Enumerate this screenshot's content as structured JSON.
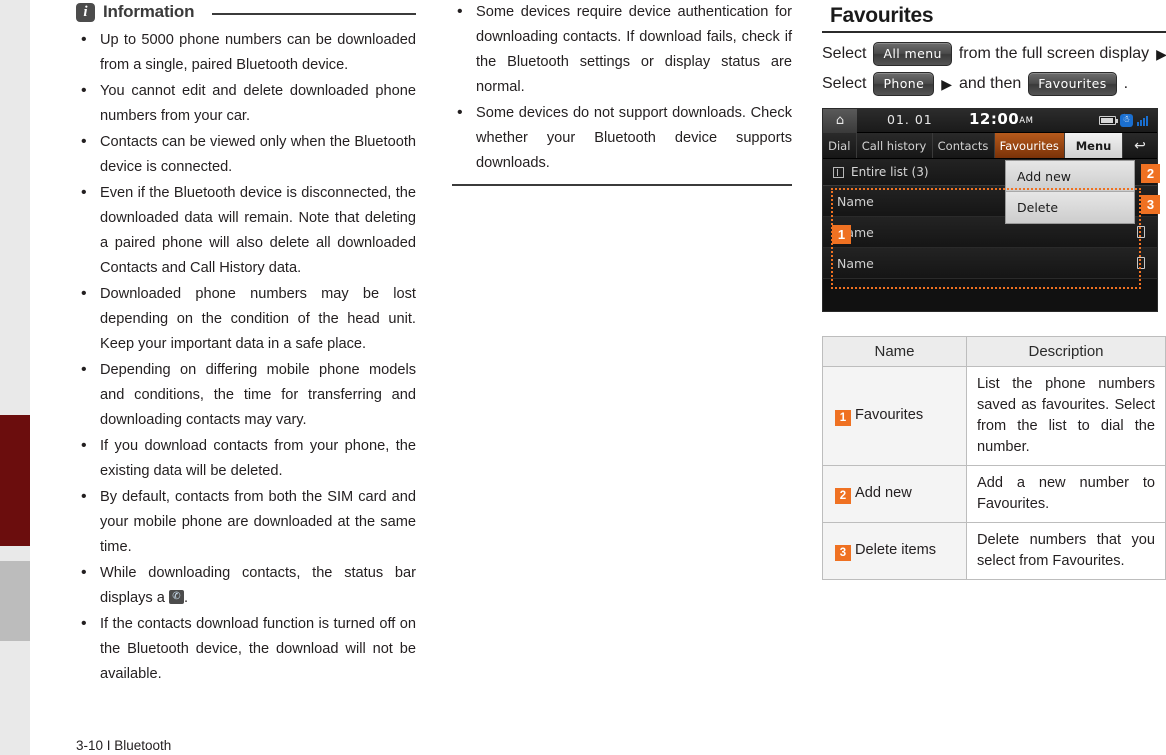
{
  "page": {
    "footer": "3-10 I Bluetooth"
  },
  "information": {
    "badge": "i",
    "title": "Information",
    "bullets": [
      "Up to 5000 phone numbers can be downloaded from a single, paired Bluetooth device.",
      "You cannot edit and delete downloaded phone numbers from your car.",
      "Contacts can be viewed only when the Bluetooth device is connected.",
      "Even if the Bluetooth device is disconnected, the downloaded data will remain. Note that deleting a paired phone will also delete all downloaded Contacts and Call History data.",
      "Downloaded phone numbers may be lost depending on the condition of the head unit. Keep your important data in a safe place.",
      "Depending on differing mobile phone models and conditions, the time for transferring and downloading contacts may vary.",
      "If you download contacts from your phone, the existing data will be deleted.",
      "By default, contacts from both the SIM card and your mobile phone are downloaded at the same time."
    ],
    "bullet_status_prefix": "While downloading contacts, the status bar displays a ",
    "bullet_status_suffix": ".",
    "bullet_status_icon": "contacts-download-icon",
    "bullet_last": "If the contacts download function is turned off on the Bluetooth device, the download will not be available."
  },
  "information_continued": {
    "bullets": [
      "Some devices require device authentication for downloading contacts. If download fails, check if the Bluetooth settings or display status are normal.",
      "Some devices do not support downloads. Check whether your Bluetooth device supports downloads."
    ]
  },
  "favourites": {
    "title": "Favourites",
    "steps": {
      "line1_pre": "Select",
      "line1_btn": "All menu",
      "line1_post": "from the full screen display",
      "line1_arrow": "▶",
      "line2_pre": "Select",
      "line2_btn": "Phone",
      "line2_arrow": "▶",
      "line2_mid": "and then",
      "line2_btn2": "Favourites",
      "line2_end": "."
    }
  },
  "device": {
    "home_icon": "home-icon",
    "date": "01. 01",
    "time": "12:00",
    "ampm": "AM",
    "sys_icons": [
      "battery-icon",
      "bluetooth-icon",
      "signal-icon"
    ],
    "tabs": [
      {
        "label": "Dial",
        "active": false
      },
      {
        "label": "Call history",
        "active": false
      },
      {
        "label": "Contacts",
        "active": false
      },
      {
        "label": "Favourites",
        "active": true
      }
    ],
    "menu_label": "Menu",
    "back_icon": "↩",
    "list_header": "Entire list (3)",
    "rows": [
      {
        "label": "Name",
        "icon": false
      },
      {
        "label": "Name",
        "icon": true
      },
      {
        "label": "Name",
        "icon": true
      }
    ],
    "dropdown": [
      {
        "label": "Add new"
      },
      {
        "label": "Delete"
      }
    ],
    "badges": [
      "1",
      "2",
      "3"
    ]
  },
  "table": {
    "headers": [
      "Name",
      "Description"
    ],
    "rows": [
      {
        "badge": "1",
        "name": "Favourites",
        "description": "List the phone numbers saved as favourites. Select from the list to dial the number."
      },
      {
        "badge": "2",
        "name": "Add new",
        "description": "Add a new number to Favourites."
      },
      {
        "badge": "3",
        "name": "Delete items",
        "description": "Delete numbers that you select from Favourites."
      }
    ]
  },
  "colors": {
    "accent_orange": "#ef7122",
    "tab_red": "#6b0d0d",
    "tab_gray": "#bcbcbc"
  }
}
